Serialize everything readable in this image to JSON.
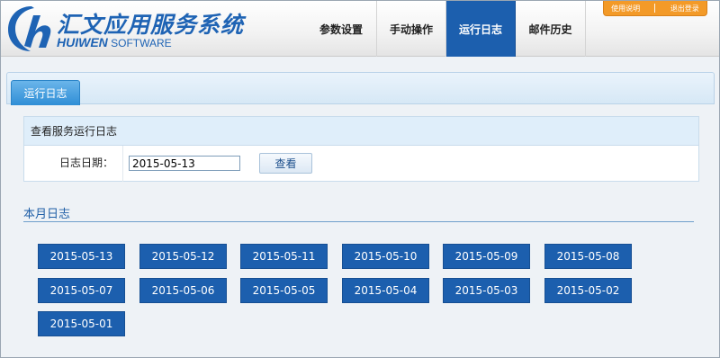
{
  "app": {
    "title_cn": "汇文应用服务系统",
    "brand_en": "HUIWEN",
    "brand_en_suffix": "SOFTWARE"
  },
  "nav": {
    "items": [
      {
        "label": "参数设置"
      },
      {
        "label": "手动操作"
      },
      {
        "label": "运行日志"
      },
      {
        "label": "邮件历史"
      }
    ],
    "active_index": 2
  },
  "utility": {
    "help": "使用说明",
    "logout": "退出登录"
  },
  "tab": {
    "label": "运行日志"
  },
  "query": {
    "section_title": "查看服务运行日志",
    "date_label": "日志日期：",
    "date_value": "2015-05-13",
    "submit_label": "查看"
  },
  "month_logs": {
    "title": "本月日志",
    "dates": [
      "2015-05-13",
      "2015-05-12",
      "2015-05-11",
      "2015-05-10",
      "2015-05-09",
      "2015-05-08",
      "2015-05-07",
      "2015-05-06",
      "2015-05-05",
      "2015-05-04",
      "2015-05-03",
      "2015-05-02",
      "2015-05-01"
    ]
  },
  "colors": {
    "brand_blue": "#1c5fae",
    "accent_orange": "#f39a28",
    "tab_blue": "#2f8ed6"
  }
}
